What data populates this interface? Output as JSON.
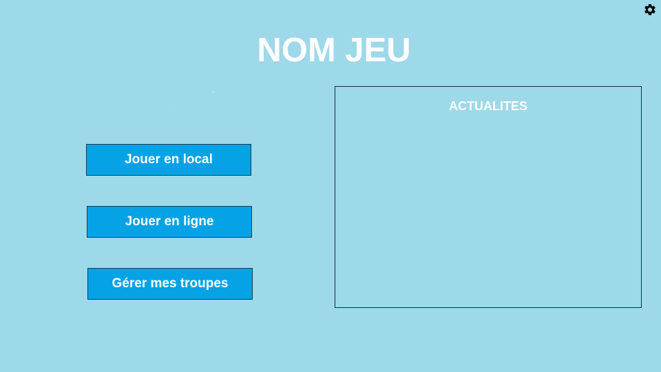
{
  "game": {
    "title": "NOM JEU"
  },
  "menu": {
    "buttons": [
      {
        "id": "local",
        "label": "Jouer en local"
      },
      {
        "id": "ligne",
        "label": "Jouer en ligne"
      },
      {
        "id": "troupes",
        "label": "Gérer mes troupes"
      }
    ]
  },
  "news": {
    "title": "ACTUALITES"
  },
  "icons": {
    "settings": "gear-icon"
  },
  "colors": {
    "background": "#9dd9e9",
    "button": "#05a2e6",
    "text": "#ffffff"
  }
}
